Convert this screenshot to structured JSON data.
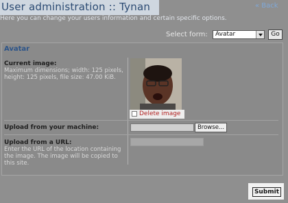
{
  "header": {
    "title": "User administration :: Tynan",
    "back_link": "« Back",
    "intro": "Here you can change your users information and certain specific options."
  },
  "select_form": {
    "label": "Select form:",
    "value": "Avatar",
    "go_label": "Go"
  },
  "avatar_section": {
    "legend": "Avatar",
    "current_image": {
      "label": "Current image:",
      "hint": "Maximum dimensions; width: 125 pixels, height: 125 pixels, file size: 47.00 KiB.",
      "delete_label": "Delete image",
      "delete_checked": false
    },
    "upload_machine": {
      "label": "Upload from your machine:",
      "browse_label": "Browse...",
      "file_value": ""
    },
    "upload_url": {
      "label": "Upload from a URL:",
      "hint": "Enter the URL of the location containing the image. The image will be copied to this site.",
      "url_value": ""
    }
  },
  "actions": {
    "submit_label": "Submit"
  },
  "colors": {
    "background": "#8f8f8f",
    "title_bg": "#cfd7e0",
    "title_text": "#2b4a72",
    "legend": "#2c5489",
    "delete_text": "#b02020"
  }
}
